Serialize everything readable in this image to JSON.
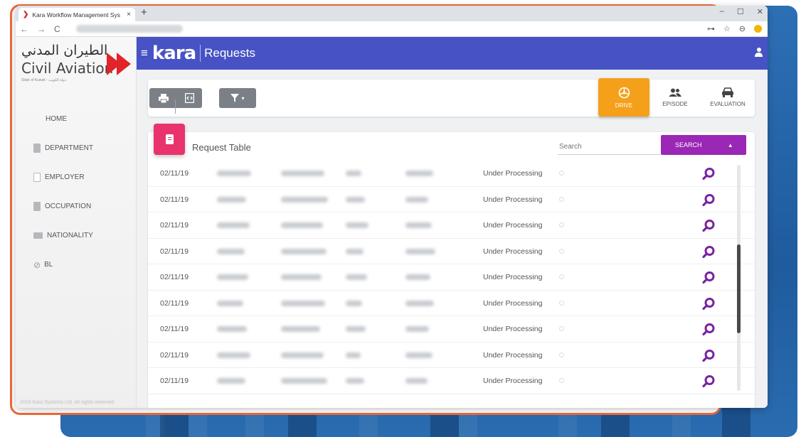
{
  "browser": {
    "tab_title": "Kara Workflow Management Sys",
    "tab_close": "×",
    "new_tab": "+",
    "window_controls": [
      "–",
      "☐",
      "✕"
    ],
    "nav_icons": [
      "←",
      "→",
      "C"
    ],
    "address_icons": [
      "⊶",
      "☆",
      "⊖"
    ]
  },
  "sidebar": {
    "logo_arabic": "الطيران المدني",
    "logo_english": "Civil Aviation",
    "logo_tagline": "State of Kuwait - دولة الكويت",
    "items": [
      {
        "label": "HOME"
      },
      {
        "label": "DEPARTMENT"
      },
      {
        "label": "EMPLOYER"
      },
      {
        "label": "OCCUPATION"
      },
      {
        "label": "NATIONALITY"
      },
      {
        "label": "BL"
      }
    ],
    "copyright": "2019 Kara Systems Ltd. All rights reserved"
  },
  "header": {
    "menu_icon": "≡",
    "brand": "kara",
    "page_title": "Requests"
  },
  "toolbar": {
    "filter_caret": "▾",
    "tabs": [
      {
        "label": "DRIVE",
        "icon": "steering-wheel",
        "active": true
      },
      {
        "label": "EPISODE",
        "icon": "users",
        "active": false
      },
      {
        "label": "EVALUATION",
        "icon": "car",
        "active": false
      }
    ]
  },
  "table": {
    "title": "Request Table",
    "search_placeholder": "Search",
    "search_button": "SEARCH",
    "search_caret": "▴",
    "rows": [
      {
        "date": "02/11/19",
        "status": "Under Processing"
      },
      {
        "date": "02/11/19",
        "status": "Under Processing"
      },
      {
        "date": "02/11/19",
        "status": "Under Processing"
      },
      {
        "date": "02/11/19",
        "status": "Under Processing"
      },
      {
        "date": "02/11/19",
        "status": "Under Processing"
      },
      {
        "date": "02/11/19",
        "status": "Under Processing"
      },
      {
        "date": "02/11/19",
        "status": "Under Processing"
      },
      {
        "date": "02/11/19",
        "status": "Under Processing"
      },
      {
        "date": "02/11/19",
        "status": "Under Processing"
      }
    ]
  },
  "colors": {
    "appbar": "#4752c4",
    "active_tab": "#f5a01a",
    "search_button": "#9a27b5",
    "badge": "#e8336d",
    "magnifier": "#7a22a0",
    "frame": "#ee6a3c",
    "backdrop": "#2d6fb5"
  }
}
